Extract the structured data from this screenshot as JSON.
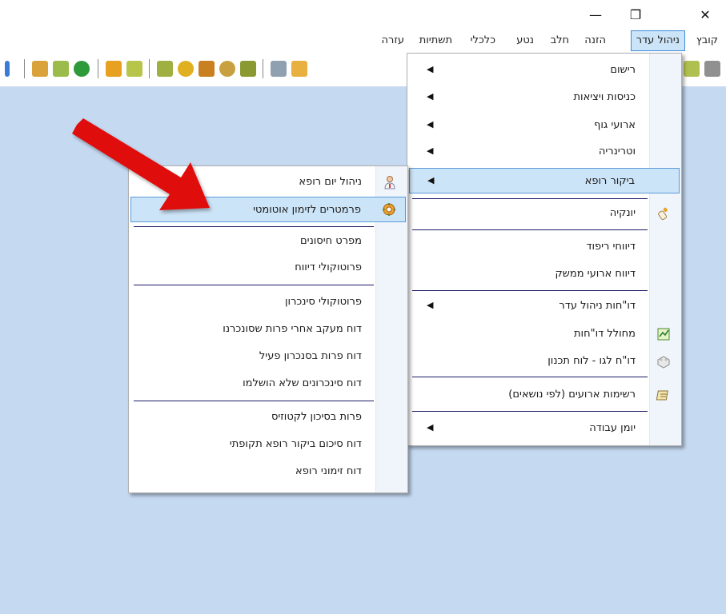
{
  "window": {
    "minimize_glyph": "—",
    "restore_glyph": "❐",
    "close_glyph": "✕"
  },
  "menubar": {
    "items": [
      "קובץ",
      "ניהול עדר",
      "הזנה",
      "חלב",
      "נטע",
      "כלכלי",
      "תשתיות",
      "עזרה"
    ],
    "active_index": 1
  },
  "herd_menu": {
    "items": [
      {
        "label": "רישום",
        "submenu": true
      },
      {
        "label": "כניסות ויציאות",
        "submenu": true
      },
      {
        "label": "ארועי גוף",
        "submenu": true
      },
      {
        "label": "וטרינריה",
        "submenu": true
      },
      {
        "label": "ביקור רופא",
        "submenu": true,
        "highlighted": true
      },
      {
        "label": "יונקיה",
        "icon": "bottle-icon"
      },
      {
        "label": "דיווחי ריפוד"
      },
      {
        "label": "דיווח ארועי ממשק"
      },
      {
        "label": "דו\"חות ניהול עדר",
        "submenu": true
      },
      {
        "label": "מחולל דו\"חות",
        "icon": "report-generator-icon"
      },
      {
        "label": "דו\"ח לגו - לוח תכנון",
        "icon": "lego-icon"
      },
      {
        "label": "רשימות ארועים (לפי נושאים)",
        "icon": "list-icon"
      },
      {
        "label": "יומן עבודה",
        "submenu": true
      }
    ]
  },
  "vet_submenu": {
    "items": [
      {
        "label": "ניהול יום רופא",
        "icon": "doctor-icon"
      },
      {
        "label": "פרמטרים לזימון אוטומטי",
        "icon": "settings-icon",
        "highlighted": true
      },
      {
        "label": "מפרט חיסונים"
      },
      {
        "label": "פרוטוקולי דיווח"
      },
      {
        "label": "פרוטוקולי סינכרון"
      },
      {
        "label": "דוח מעקב אחרי פרות שסונכרנו"
      },
      {
        "label": "דוח פרות בסנכרון פעיל"
      },
      {
        "label": "דוח סינכרונים שלא הושלמו"
      },
      {
        "label": "פרות בסיכון לקטוזיס"
      },
      {
        "label": "דוח סיכום ביקור רופא תקופתי"
      },
      {
        "label": "דוח זימוני רופא"
      }
    ]
  },
  "colors": {
    "workspace": "#c5d9f1",
    "highlight": "#cce4f7",
    "highlight_border": "#5a9bd8",
    "arrow": "#e01010"
  }
}
